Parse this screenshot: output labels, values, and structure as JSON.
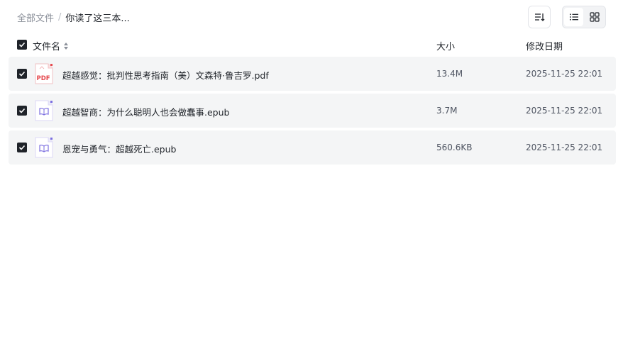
{
  "breadcrumb": {
    "root": "全部文件",
    "separator": "/",
    "current": "你读了这三本..."
  },
  "toolbar": {
    "sort_icon": "sort-icon",
    "view_list_icon": "list-view-icon",
    "view_grid_icon": "grid-view-icon",
    "active_view": "list"
  },
  "table": {
    "headers": {
      "name": "文件名",
      "size": "大小",
      "modified": "修改日期"
    },
    "rows": [
      {
        "name": "超越感觉：批判性思考指南（美）文森特·鲁吉罗.pdf",
        "type": "pdf",
        "type_label": "PDF",
        "size": "13.4M",
        "modified": "2025-11-25 22:01",
        "checked": true
      },
      {
        "name": "超越智商：为什么聪明人也会做蠢事.epub",
        "type": "epub",
        "size": "3.7M",
        "modified": "2025-11-25 22:01",
        "checked": true
      },
      {
        "name": "恩宠与勇气：超越死亡.epub",
        "type": "epub",
        "size": "560.6KB",
        "modified": "2025-11-25 22:01",
        "checked": true
      }
    ]
  },
  "colors": {
    "checkbox": "#1f2329",
    "row_bg": "#f4f5f6",
    "pdf_red": "#e5484d",
    "epub_purple": "#7b6ee0"
  }
}
